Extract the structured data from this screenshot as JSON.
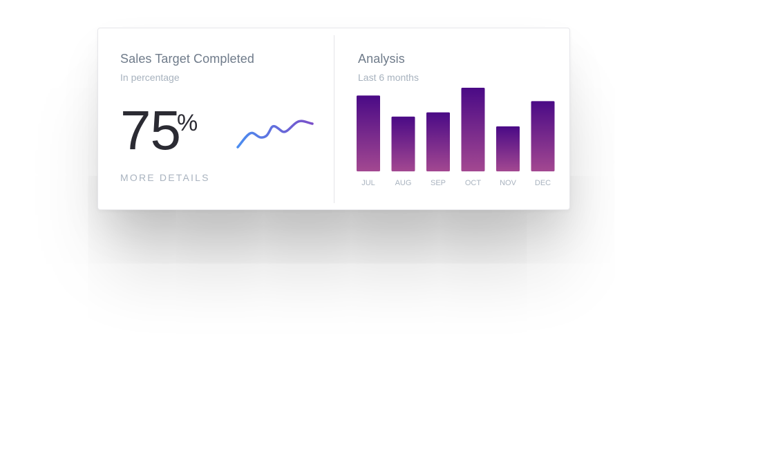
{
  "sales_panel": {
    "title": "Sales Target Completed",
    "subtitle": "In percentage",
    "value": "75",
    "unit": "%",
    "more_label": "MORE DETAILS",
    "sparkline_colors": [
      "#4b8df0",
      "#7a4fc9"
    ]
  },
  "analysis_panel": {
    "title": "Analysis",
    "subtitle": "Last 6 months"
  },
  "chart_data": {
    "type": "bar",
    "categories": [
      "JUL",
      "AUG",
      "SEP",
      "OCT",
      "NOV",
      "DEC"
    ],
    "values": [
      108,
      78,
      84,
      119,
      64,
      100
    ],
    "ylim": [
      0,
      120
    ],
    "grid": false,
    "bar_gradient": [
      "#4a0a86",
      "#a34891"
    ]
  }
}
